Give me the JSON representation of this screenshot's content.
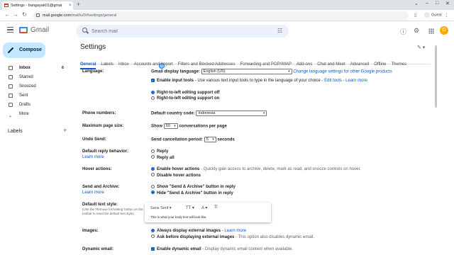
{
  "browser": {
    "tab_title": "Settings - bangayak01@gmai",
    "tab_close": "×",
    "new_tab": "+",
    "url_host": "mail.google.com",
    "url_path": "/mail/u/0/#settings/general",
    "guest_label": "Guest",
    "nav_icons": [
      "back-icon",
      "forward-icon",
      "reload-icon"
    ]
  },
  "gmail": {
    "product": "Gmail",
    "search_placeholder": "Search mail",
    "avatar_initial": "G"
  },
  "sidebar": {
    "compose_label": "Compose",
    "items": [
      {
        "label": "Inbox",
        "count": "6",
        "active": true
      },
      {
        "label": "Starred"
      },
      {
        "label": "Snoozed"
      },
      {
        "label": "Sent"
      },
      {
        "label": "Drafts"
      },
      {
        "label": "More"
      }
    ],
    "labels_title": "Labels",
    "labels_add": "+"
  },
  "settings": {
    "title": "Settings",
    "tabs": [
      "General",
      "Labels",
      "Inbox",
      "Accounts and Import",
      "Filters and Blocked Addresses",
      "Forwarding and POP/IMAP",
      "Add-ons",
      "Chat and Meet",
      "Advanced",
      "Offline",
      "Themes"
    ],
    "language": {
      "label": "Language:",
      "display_label": "Gmail display language:",
      "display_value": "English (US)",
      "change_link": "Change language settings for other Google products",
      "input_tools_label": "Enable input tools",
      "input_tools_desc": " - Use various text input tools to type in the language of your choice - ",
      "edit_tools": "Edit tools",
      "sep": " - ",
      "learn_more": "Learn more",
      "rtl_off": "Right-to-left editing support off",
      "rtl_on": "Right-to-left editing support on"
    },
    "phone": {
      "label": "Phone numbers:",
      "country_label": "Default country code:",
      "country_value": "Indonesia"
    },
    "page_size": {
      "label": "Maximum page size:",
      "show": "Show",
      "value": "50",
      "suffix": "conversations per page"
    },
    "undo_send": {
      "label": "Undo Send:",
      "period_label": "Send cancellation period:",
      "value": "5",
      "suffix": "seconds"
    },
    "reply": {
      "label": "Default reply behavior:",
      "learn_more": "Learn more",
      "opt1": "Reply",
      "opt2": "Reply all"
    },
    "hover": {
      "label": "Hover actions:",
      "opt1": "Enable hover actions",
      "opt1_desc": " - Quickly gain access to archive, delete, mark as read, and snooze controls on hover.",
      "opt2": "Disable hover actions"
    },
    "send_archive": {
      "label": "Send and Archive:",
      "learn_more": "Learn more",
      "opt1": "Show \"Send & Archive\" button in reply",
      "opt2": "Hide \"Send & Archive\" button in reply"
    },
    "text_style": {
      "label": "Default text style:",
      "sub": "(Use the 'Remove formatting' button on the toolbar to reset the default text style)",
      "font": "Sans Serif",
      "sample": "This is what your body text will look like."
    },
    "images": {
      "label": "Images:",
      "opt1": "Always display external images",
      "opt1_link": "Learn more",
      "opt2": "Ask before displaying external images",
      "opt2_desc": " - This option also disables dynamic email."
    },
    "dynamic": {
      "label": "Dynamic email:",
      "opt1": "Enable dynamic email",
      "opt1_desc": " - Display dynamic email content when available."
    }
  }
}
